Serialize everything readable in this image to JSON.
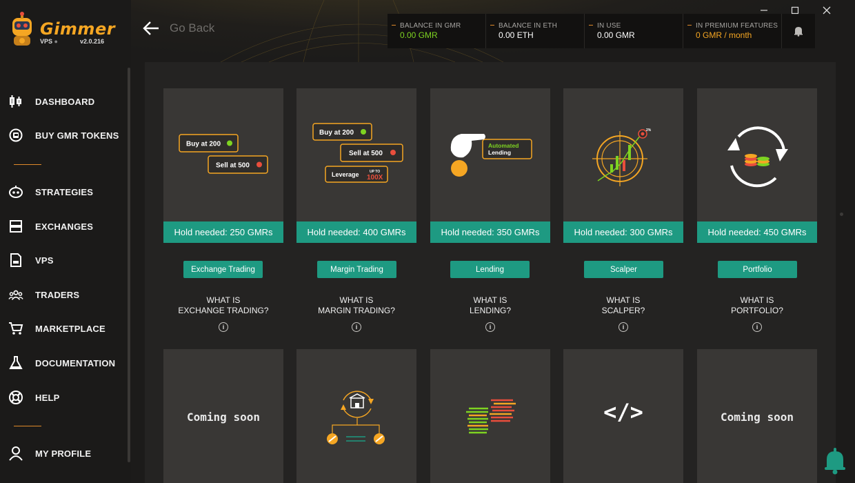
{
  "app": {
    "logo_text": "Gimmer",
    "tier": "VPS",
    "version": "v2.0.216"
  },
  "nav": {
    "dashboard": "DASHBOARD",
    "buy_tokens": "BUY GMR TOKENS",
    "strategies": "STRATEGIES",
    "exchanges": "EXCHANGES",
    "vps": "VPS",
    "traders": "TRADERS",
    "marketplace": "MARKETPLACE",
    "documentation": "DOCUMENTATION",
    "help": "HELP",
    "profile": "MY PROFILE"
  },
  "header": {
    "back_label": "Go Back",
    "balances": [
      {
        "label": "BALANCE IN GMR",
        "value": "0.00 GMR",
        "color": "#7ed321"
      },
      {
        "label": "BALANCE IN ETH",
        "value": "0.00 ETH",
        "color": "#ffffff"
      },
      {
        "label": "IN USE",
        "value": "0.00 GMR",
        "color": "#ffffff"
      },
      {
        "label": "IN PREMIUM FEATURES",
        "value": "0 GMR / month",
        "color": "#f5a623"
      }
    ]
  },
  "cards": [
    {
      "hold": "Hold needed: 250 GMRs",
      "category": "Exchange Trading",
      "what1": "WHAT IS",
      "what2": "EXCHANGE TRADING?",
      "info": "i",
      "badges": [
        "Buy at 200",
        "Sell at 500"
      ]
    },
    {
      "hold": "Hold needed: 400 GMRs",
      "category": "Margin Trading",
      "what1": "WHAT IS",
      "what2": "MARGIN TRADING?",
      "info": "i",
      "badges": [
        "Buy at 200",
        "Sell at 500",
        "Leverage",
        "UP TO",
        "100X"
      ]
    },
    {
      "hold": "Hold needed: 350 GMRs",
      "category": "Lending",
      "what1": "WHAT IS",
      "what2": "LENDING?",
      "info": "i",
      "badges": [
        "Automated",
        "Lending"
      ]
    },
    {
      "hold": "Hold needed: 300 GMRs",
      "category": "Scalper",
      "what1": "WHAT IS",
      "what2": "SCALPER?",
      "info": "i",
      "badges": [
        "2%"
      ]
    },
    {
      "hold": "Hold needed: 450 GMRs",
      "category": "Portfolio",
      "what1": "WHAT IS",
      "what2": "PORTFOLIO?",
      "info": "i"
    }
  ],
  "row2": {
    "coming_soon_1": "Coming soon",
    "coming_soon_2": "Coming soon",
    "code_symbol": "</>"
  },
  "colors": {
    "accent_orange": "#f5a623",
    "teal": "#1e9a82",
    "green": "#7ed321",
    "red": "#e94e3c"
  }
}
